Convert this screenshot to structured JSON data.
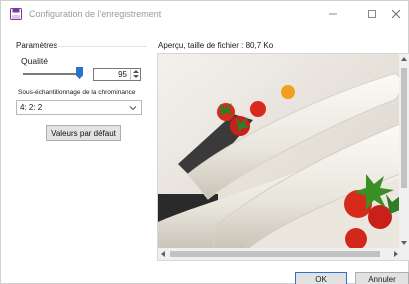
{
  "window": {
    "title": "Configuration de l'enregistrement",
    "icon": "save-disk-icon",
    "controls": {
      "minimize_icon": "minimize-icon",
      "maximize_icon": "maximize-icon",
      "close_icon": "close-icon"
    }
  },
  "settings": {
    "group_label": "Paramètres",
    "quality": {
      "label": "Qualité",
      "value": "95",
      "slider_level": 95,
      "slider_max": 100
    },
    "chroma": {
      "label": "Sous-échantillonnage de la chrominance",
      "selected": "4: 2: 2"
    },
    "default_button": "Valeurs par défaut"
  },
  "preview": {
    "label": "Aperçu, taille de fichier : 80,7 Ko"
  },
  "footer": {
    "ok_label": "OK",
    "cancel_label": "Annuler"
  },
  "colors": {
    "accent": "#2a73c9",
    "close_hover": "#e81123"
  }
}
